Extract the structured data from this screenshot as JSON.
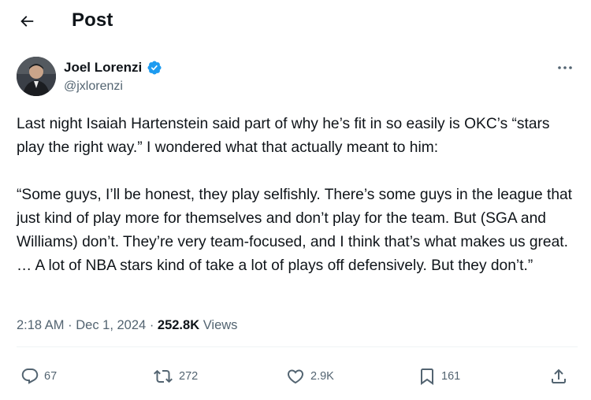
{
  "header": {
    "title": "Post",
    "back_icon": "arrow-left-icon"
  },
  "author": {
    "name": "Joel Lorenzi",
    "handle": "@jxlorenzi",
    "verified_icon": "verified-badge-icon",
    "verified_color": "#1d9bf0"
  },
  "tweet": {
    "paragraph_1": "Last night Isaiah Hartenstein said part of why he’s fit in so easily is OKC’s “stars play the right way.” I wondered what that actually meant to him:",
    "paragraph_2": "“Some guys, I’ll be honest, they play selfishly. There’s some guys in the league that just kind of play more for themselves and don’t play for the team. But (SGA and Williams) don’t. They’re very team-focused, and I think that’s what makes us great. … A lot of NBA stars kind of take a lot of plays off defensively. But they don’t.”"
  },
  "meta": {
    "time": "2:18 AM",
    "sep1": "·",
    "date": "Dec 1, 2024",
    "sep2": "·",
    "views_count": "252.8K",
    "views_label": "Views"
  },
  "actions": {
    "replies": "67",
    "reposts": "272",
    "likes": "2.9K",
    "bookmarks": "161"
  },
  "colors": {
    "text_primary": "#0f1419",
    "text_secondary": "#536471",
    "divider": "#eff3f4"
  }
}
